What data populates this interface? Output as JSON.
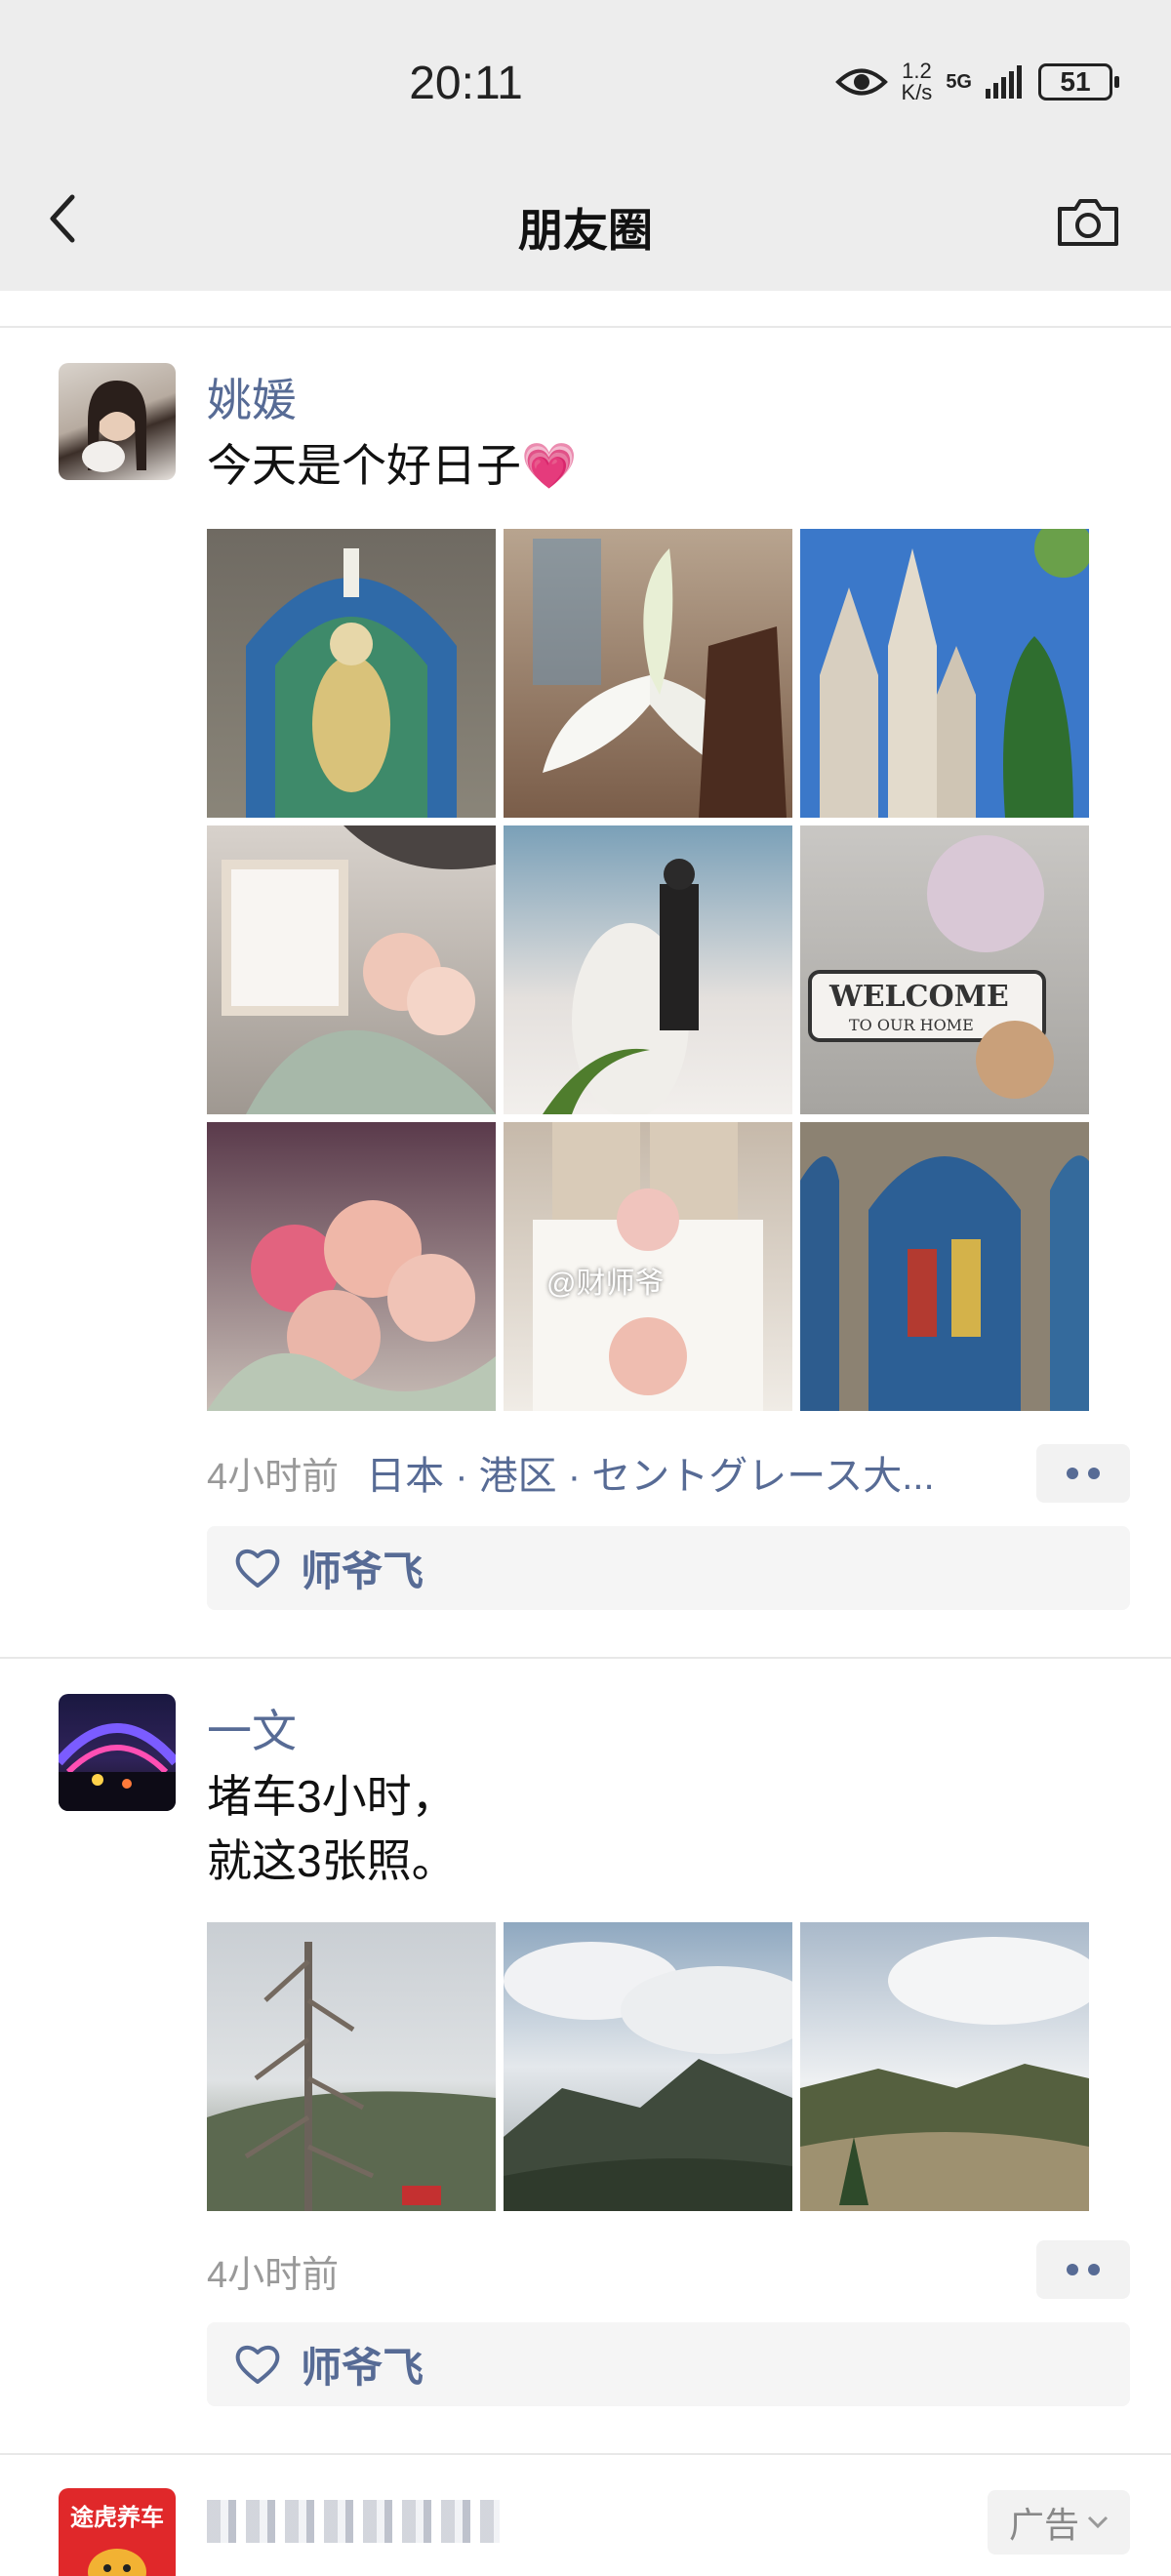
{
  "status_bar": {
    "time": "20:11",
    "net_speed_top": "1.2",
    "net_speed_bottom": "K/s",
    "network": "5G",
    "battery": "51"
  },
  "nav": {
    "title": "朋友圈"
  },
  "posts": [
    {
      "author": "姚媛",
      "text": "今天是个好日子💗",
      "time": "4小时前",
      "location": "日本 · 港区 · セントグレース大...",
      "likes": "师爷飞",
      "watermark": "@财师爷",
      "photos": [
        "stained-glass-window",
        "white-lily",
        "gothic-church",
        "wedding-photo-frame-flowers",
        "bride-and-groom",
        "welcome-sign-teddy-bear",
        "pink-rose-bouquet",
        "banquet-table",
        "stained-glass-arches"
      ]
    },
    {
      "author": "一文",
      "text": "堵车3小时，\n就这3张照。",
      "time": "4小时前",
      "likes": "师爷飞",
      "photos": [
        "bare-tree-mountain",
        "cloudy-mountain-ridge",
        "mountain-meadow"
      ]
    }
  ],
  "ad": {
    "avatar_label": "途虎养车",
    "tag": "广告"
  },
  "colors": {
    "link": "#576b95",
    "bar_bg": "#ededed",
    "like_bg": "#f5f5f5"
  }
}
